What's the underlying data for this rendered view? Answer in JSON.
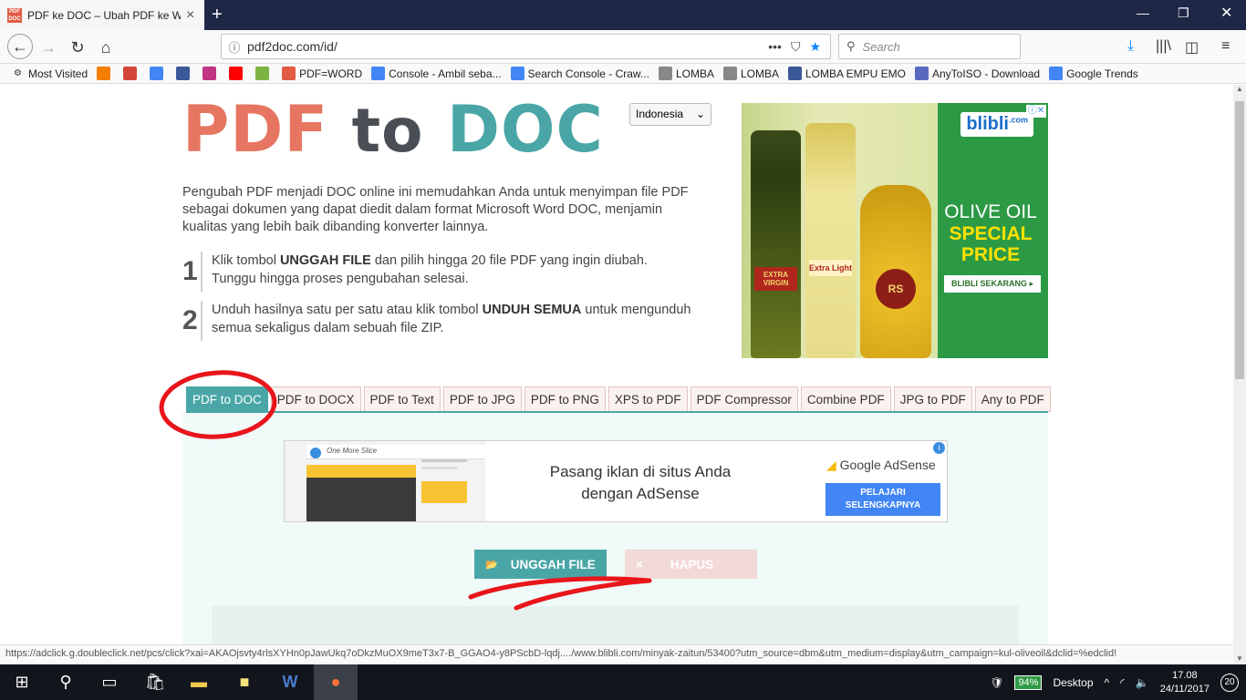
{
  "browser": {
    "tab_title": "PDF ke DOC – Ubah PDF ke Wo",
    "favicon_text": "PDF DOC",
    "url": "pdf2doc.com/id/",
    "search_placeholder": "Search",
    "status_url": "https://adclick.g.doubleclick.net/pcs/click?xai=AKAOjsvty4rlsXYHn0pJawUkq7oDkzMuOX9meT3x7-B_GGAO4-y8PScbD-lqdj..../www.blibli.com/minyak-zaitun/53400?utm_source=dbm&utm_medium=display&utm_campaign=kul-oliveoil&dclid=%edclid!"
  },
  "bookmarks": [
    {
      "label": "Most Visited",
      "icon": "gear-icon"
    },
    {
      "label": "",
      "icon": "blogger-icon",
      "color": "#f57d00"
    },
    {
      "label": "",
      "icon": "gmail-icon",
      "color": "#d44638"
    },
    {
      "label": "",
      "icon": "google-icon",
      "color": "#4285f4"
    },
    {
      "label": "",
      "icon": "facebook-icon",
      "color": "#3b5998"
    },
    {
      "label": "",
      "icon": "instagram-icon",
      "color": "#c13584"
    },
    {
      "label": "",
      "icon": "youtube-icon",
      "color": "#ff0000"
    },
    {
      "label": "",
      "icon": "download-icon",
      "color": "#7cb342"
    },
    {
      "label": "PDF=WORD",
      "icon": "pdf-icon",
      "color": "#e25b44"
    },
    {
      "label": "Console - Ambil seba...",
      "icon": "google-icon",
      "color": "#4285f4"
    },
    {
      "label": "Search Console - Craw...",
      "icon": "google-icon",
      "color": "#4285f4"
    },
    {
      "label": "LOMBA",
      "icon": "lomba-icon",
      "color": "#888888"
    },
    {
      "label": "LOMBA",
      "icon": "lomba-icon",
      "color": "#888888"
    },
    {
      "label": "LOMBA EMPU EMO",
      "icon": "facebook-icon",
      "color": "#3b5998"
    },
    {
      "label": "AnyToISO - Download",
      "icon": "anytoiso-icon",
      "color": "#5a6abf"
    },
    {
      "label": "Google Trends",
      "icon": "trends-icon",
      "color": "#4285f4"
    }
  ],
  "page": {
    "logo": {
      "pdf": "PDF",
      "to": "to",
      "doc": "DOC"
    },
    "language": "Indonesia",
    "intro": "Pengubah PDF menjadi DOC online ini memudahkan Anda untuk menyimpan file PDF sebagai dokumen yang dapat diedit dalam format Microsoft Word DOC, menjamin kualitas yang lebih baik dibanding konverter lainnya.",
    "steps": [
      {
        "num": "1",
        "pre": "Klik tombol ",
        "bold": "UNGGAH FILE",
        "post": " dan pilih hingga 20 file PDF yang ingin diubah. Tunggu hingga proses pengubahan selesai."
      },
      {
        "num": "2",
        "pre": "Unduh hasilnya satu per satu atau klik tombol ",
        "bold": "UNDUH SEMUA",
        "post": " untuk mengunduh semua sekaligus dalam sebuah file ZIP."
      }
    ],
    "tabs": [
      "PDF to DOC",
      "PDF to DOCX",
      "PDF to Text",
      "PDF to JPG",
      "PDF to PNG",
      "XPS to PDF",
      "PDF Compressor",
      "Combine PDF",
      "JPG to PDF",
      "Any to PDF"
    ],
    "upload_label": "UNGGAH FILE",
    "clear_label": "HAPUS",
    "clear_icon": "×"
  },
  "ad_blibli": {
    "brand": "blibli",
    "brand_suffix": ".com",
    "headline": "OLIVE OIL",
    "special": "SPECIAL PRICE",
    "cta": "BLIBLI SEKARANG ▸",
    "bottle_labels": [
      "EXTRA VIRGIN",
      "Extra Light",
      "RS"
    ]
  },
  "ad_adsense": {
    "blog_name": "One More Slice",
    "message": "Pasang iklan di situs Anda dengan AdSense",
    "brand": "Google AdSense",
    "button": "PELAJARI SELENGKAPNYA"
  },
  "taskbar": {
    "battery": "94%",
    "desktop": "Desktop",
    "time": "17.08",
    "date": "24/11/2017",
    "notifications": "20"
  }
}
